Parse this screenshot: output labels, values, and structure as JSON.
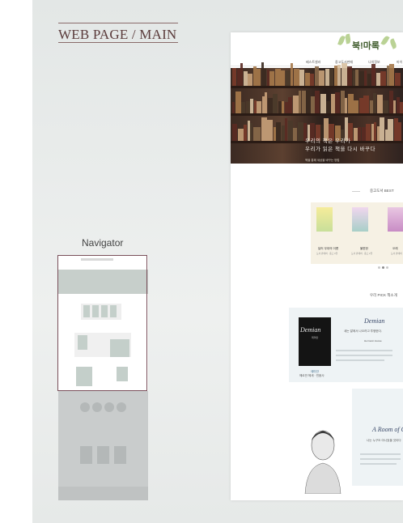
{
  "heading": "WEB PAGE / MAIN",
  "navigator_label": "Navigator",
  "site": {
    "logo": "북!마록",
    "logo_sub": "",
    "menu": [
      "베스트셀러",
      "중고도서판매",
      "나의정보",
      "마이"
    ],
    "hero_line1": "우리의 책은 우리가",
    "hero_line2": "우리가 읽은 책을 다시 바꾸다",
    "hero_small": "책을 통해 세상을 바꾸는 방법",
    "best_title": "중고도서 BEST",
    "best_books": [
      {
        "title": "달러 무대의 이름",
        "meta": "도서 판매처 · 중고 3권",
        "color": "#f3e28a"
      },
      {
        "title": "불편한",
        "meta": "도서 판매처 · 중고 2권",
        "color": "#d9c3e6"
      },
      {
        "title": "오래",
        "meta": "도서 판매처",
        "color": "#e9c7e2"
      }
    ],
    "pick_title": "우리 PICK 책소개",
    "pick_book": "Demian",
    "pick_book_sub": "데미안",
    "pick_script": "Demian",
    "pick_quote": "새는 알에서 나오려고 투쟁한다.",
    "pick_author": "Hermann Hesse",
    "pick_caption": "데미안",
    "pick_caption2": "헤르만 헤세 · 민음사",
    "room_script": "A Room of O",
    "room_quote": "나는 누구도 아니었을 것이다"
  },
  "colors": {
    "accent": "#7a4f5a",
    "logo_green": "#3d5a2a"
  }
}
